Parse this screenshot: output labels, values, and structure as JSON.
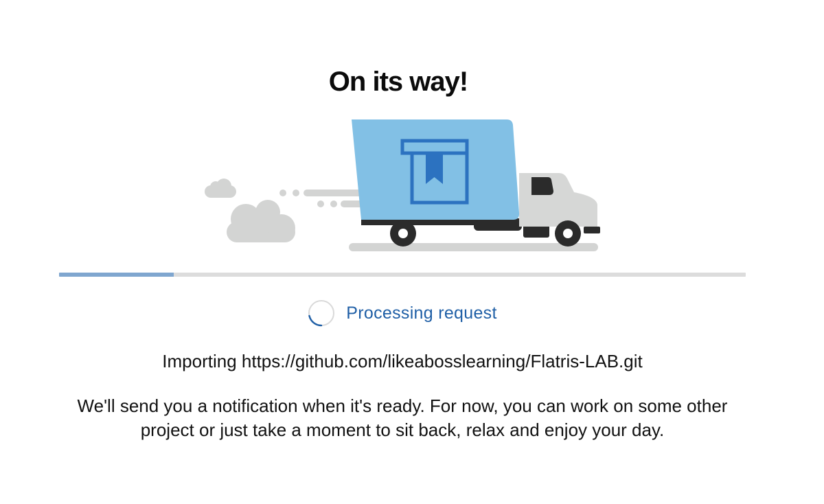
{
  "heading": "On its way!",
  "progress": {
    "fraction": 0.167,
    "track_color": "#dcdcdc",
    "fill_color": "#7fa6cf"
  },
  "status": {
    "text": "Processing request",
    "color": "#1f5fa6",
    "icon": "loading-spinner-icon"
  },
  "import_message": "Importing https://github.com/likeabosslearning/Flatris-LAB.git",
  "notification_message": "We'll send you a notification when it's ready. For now, you can work on some other project or just take a moment to sit back, relax and enjoy your day.",
  "illustration": {
    "icon": "delivery-truck-icon",
    "cargo_icon": "bookmark-box-icon",
    "colors": {
      "cargo": "#82c0e5",
      "cargo_accent": "#2c72c0",
      "cab": "#d6d7d6",
      "wheels": "#2b2b2b",
      "clouds": "#d3d4d3"
    }
  }
}
